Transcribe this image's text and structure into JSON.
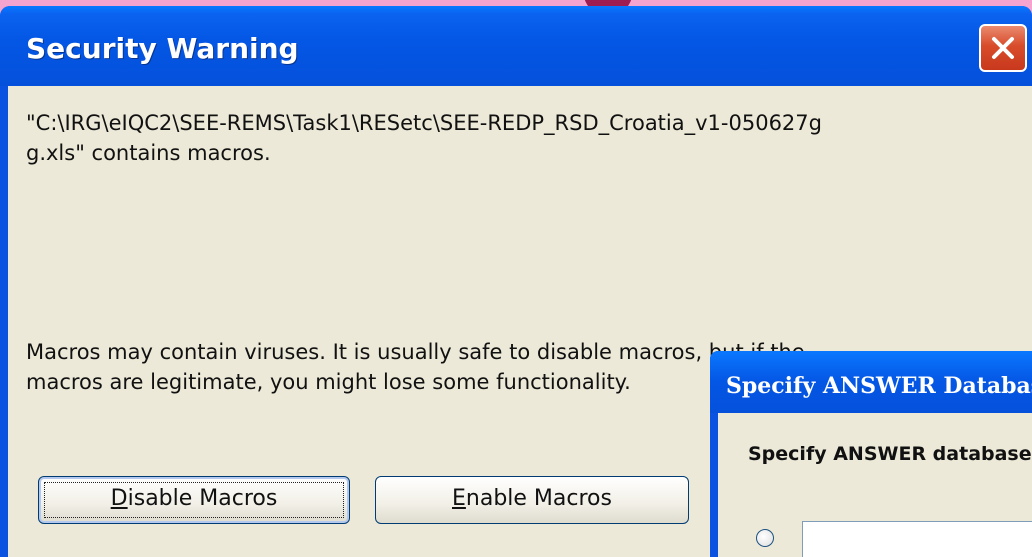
{
  "security_warning": {
    "title": "Security Warning",
    "message_path": "\"C:\\IRG\\eIQC2\\SEE-REMS\\Task1\\RESetc\\SEE-REDP_RSD_Croatia_v1-050627g",
    "message_path_cont": "g.xls\" contains macros.",
    "macro_notice_line1": "Macros may contain viruses. It is usually safe to disable macros, but if the",
    "macro_notice_line2": "macros are legitimate, you might lose some functionality.",
    "disable_button": {
      "mnemonic": "D",
      "rest": "isable Macros"
    },
    "enable_button": {
      "mnemonic": "E",
      "rest": "nable Macros"
    },
    "close_icon": "close-icon"
  },
  "answer_dialog": {
    "title": "Specify ANSWER Database",
    "prompt": "Specify ANSWER database",
    "path_value": ""
  },
  "colors": {
    "titlebar": "#0456e4",
    "client": "#ece9d8",
    "close": "#d84c2b",
    "background": "#f4a4cf"
  }
}
